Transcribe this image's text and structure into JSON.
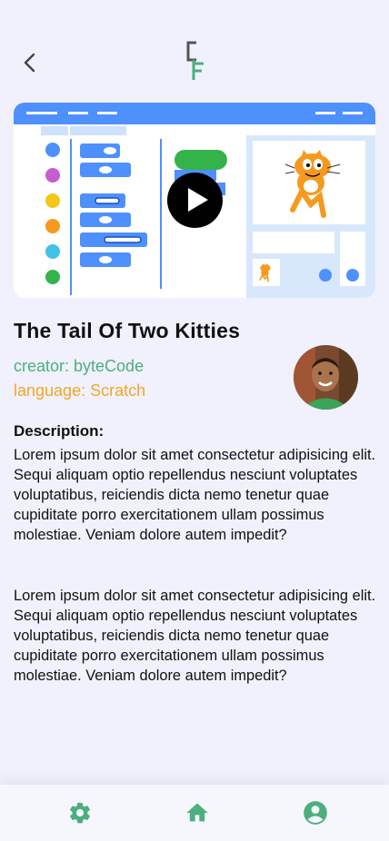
{
  "header": {
    "back_icon": "chevron-left-icon",
    "logo_letters": "CF"
  },
  "video": {
    "thumbnail": "scratch-editor-preview",
    "play_icon": "play-icon"
  },
  "project": {
    "title": "The Tail Of Two Kitties",
    "creator": "creator: byteCode",
    "language": "language: Scratch"
  },
  "description": {
    "label": "Description:",
    "paragraphs": [
      "Lorem ipsum dolor sit amet consectetur adipisicing elit. Sequi aliquam optio repellendus nesciunt voluptates voluptatibus, reiciendis dicta nemo tenetur quae cupiditate porro exercitationem ullam possimus molestiae. Veniam dolore autem impedit?",
      "Lorem ipsum dolor sit amet consectetur adipisicing elit. Sequi aliquam optio repellendus nesciunt voluptates voluptatibus, reiciendis dicta nemo tenetur quae cupiditate porro exercitationem ullam possimus molestiae. Veniam dolore autem impedit?"
    ]
  },
  "footer": {
    "items": [
      {
        "icon": "gear-icon"
      },
      {
        "icon": "home-icon"
      },
      {
        "icon": "user-circle-icon"
      }
    ]
  },
  "colors": {
    "background": "#f0f1fd",
    "accent_green": "#4caf7d",
    "accent_orange": "#f5a623",
    "video_bar_blue": "#4d90fe"
  }
}
